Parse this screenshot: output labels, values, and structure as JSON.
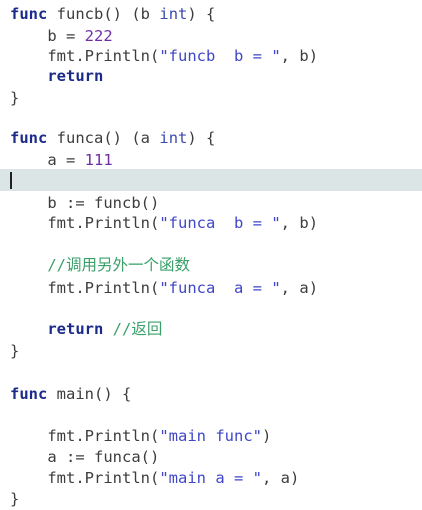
{
  "editor": {
    "current_line_color": "#dbe5e5",
    "keyword_color": "#1c2a8a",
    "string_color": "#3f46c9",
    "number_color": "#6e2fa3",
    "comment_color": "#3aa06a",
    "lines": [
      {
        "text": "func funcb() (b int) {"
      },
      {
        "text": "    b = 222"
      },
      {
        "text": "    fmt.Println(\"funcb  b = \", b)"
      },
      {
        "text": "    return"
      },
      {
        "text": "}"
      },
      {
        "text": ""
      },
      {
        "text": "func funca() (a int) {"
      },
      {
        "text": "    a = 111"
      },
      {
        "text": ""
      },
      {
        "text": "    b := funcb()"
      },
      {
        "text": "    fmt.Println(\"funca  b = \", b)"
      },
      {
        "text": ""
      },
      {
        "text": "    //调用另外一个函数"
      },
      {
        "text": "    fmt.Println(\"funca  a = \", a)"
      },
      {
        "text": ""
      },
      {
        "text": "    return //返回"
      },
      {
        "text": "}"
      },
      {
        "text": ""
      },
      {
        "text": "func main() {"
      },
      {
        "text": ""
      },
      {
        "text": "    fmt.Println(\"main func\")"
      },
      {
        "text": "    a := funca()"
      },
      {
        "text": "    fmt.Println(\"main a = \", a)"
      },
      {
        "text": "}"
      }
    ]
  }
}
